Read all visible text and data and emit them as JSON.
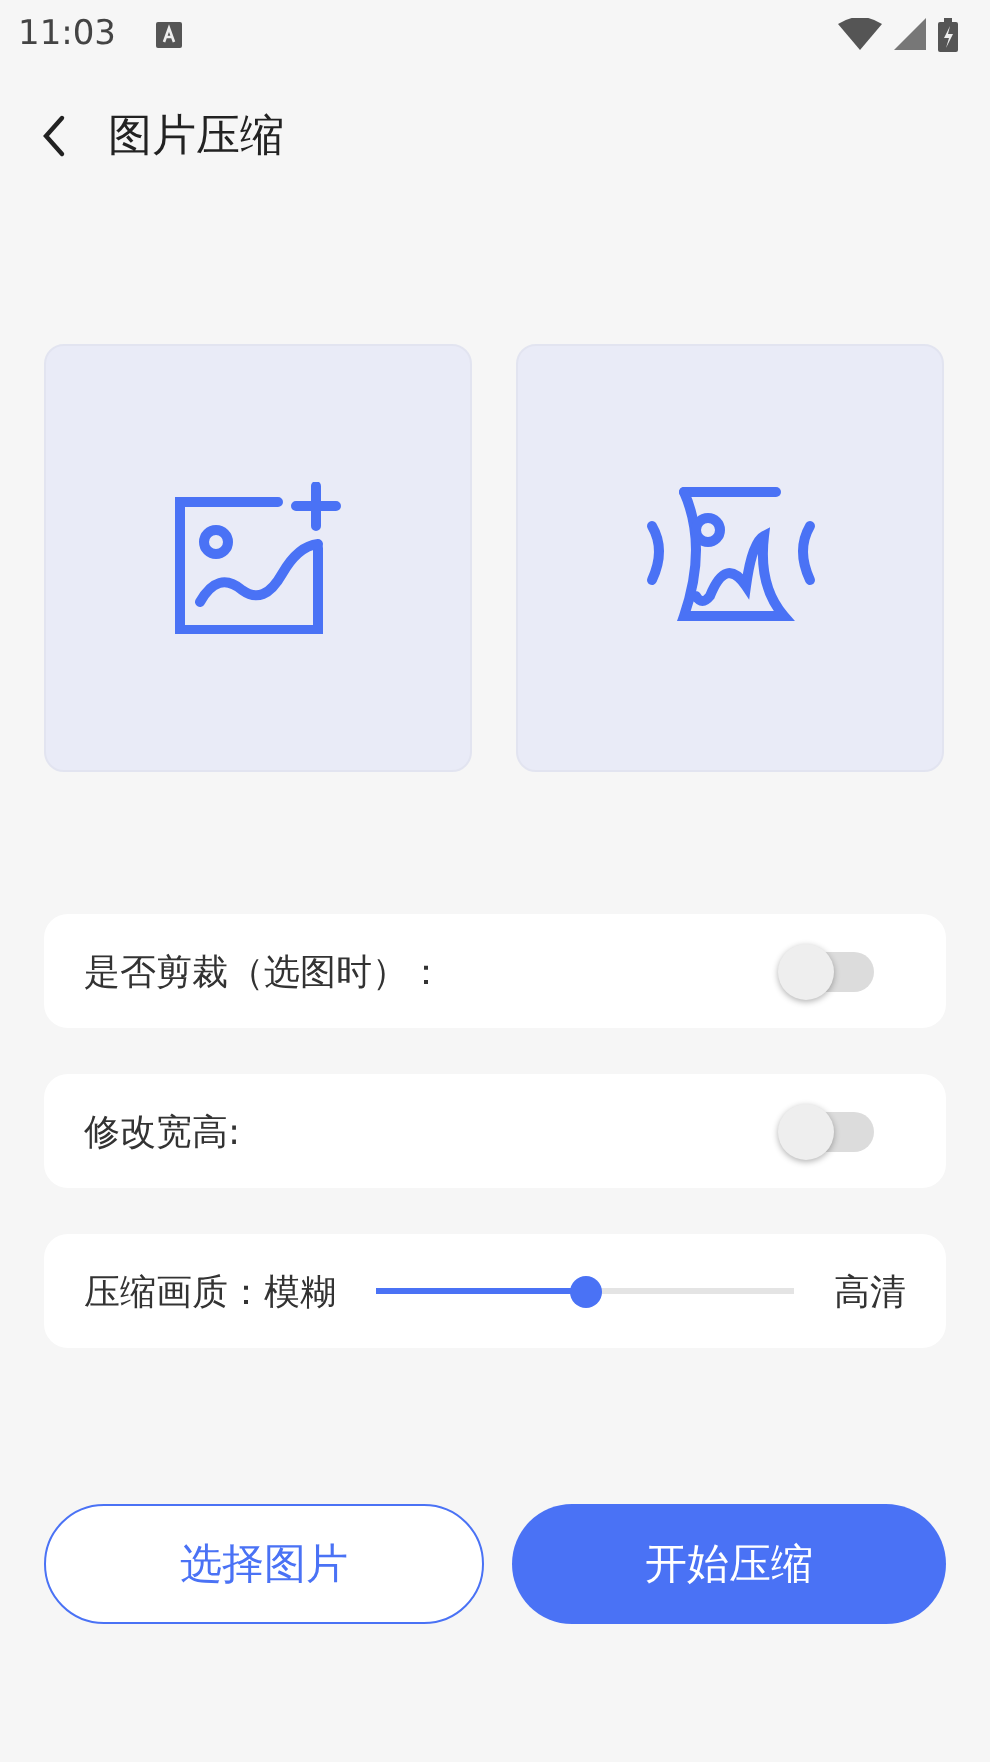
{
  "status_bar": {
    "time": "11:03"
  },
  "header": {
    "title": "图片压缩"
  },
  "tiles": [
    {
      "kind": "add"
    },
    {
      "kind": "compress"
    }
  ],
  "settings": [
    {
      "kind": "switch",
      "label": "是否剪裁（选图时）：",
      "on": false
    },
    {
      "kind": "switch",
      "label": "修改宽高:",
      "on": false
    },
    {
      "kind": "slider",
      "label": "压缩画质：模糊",
      "end_label": "高清",
      "level": 0.5
    }
  ],
  "buttons": [
    {
      "label": "选择图片",
      "kind": "outline"
    },
    {
      "label": "开始压缩",
      "kind": "filled"
    }
  ]
}
